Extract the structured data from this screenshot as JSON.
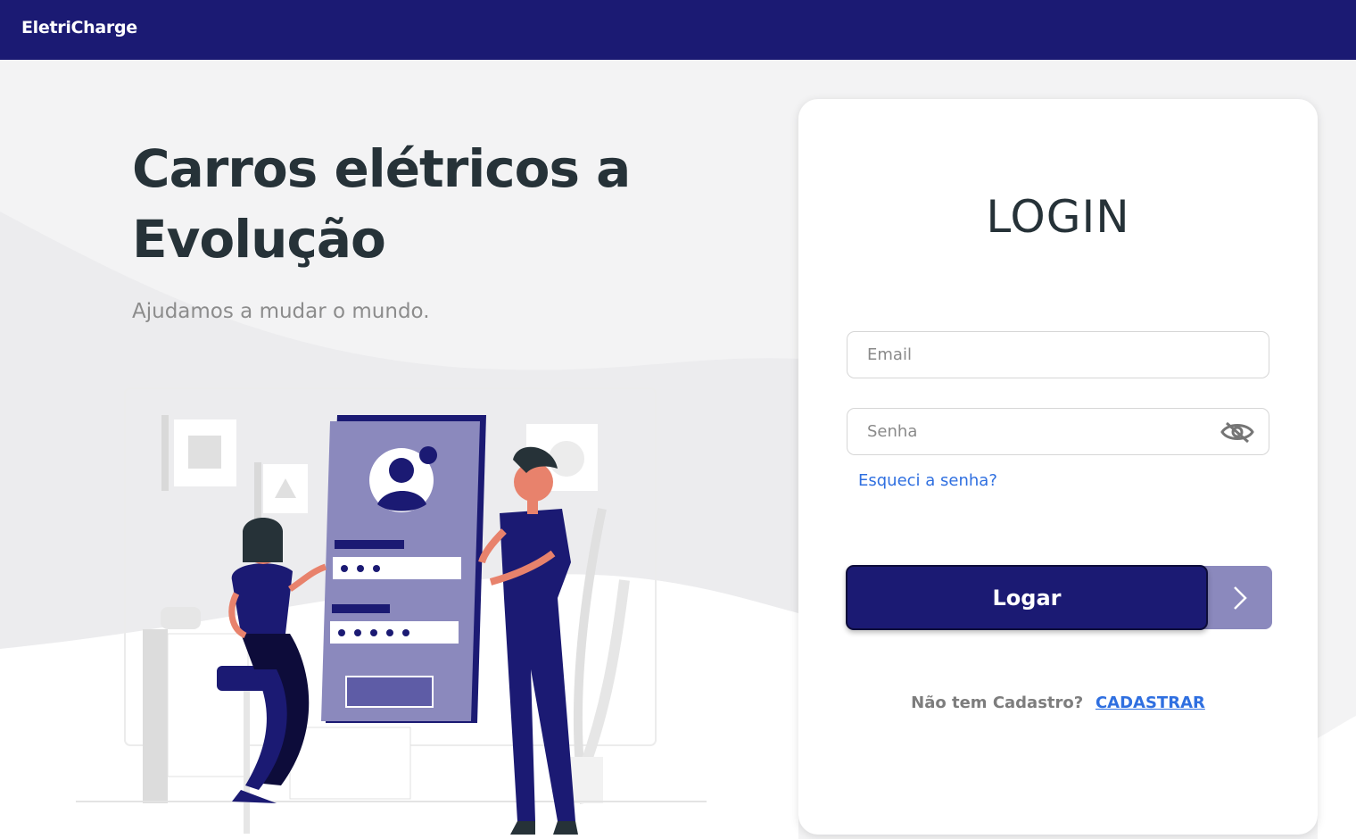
{
  "header": {
    "brand": "EletriCharge"
  },
  "hero": {
    "title": "Carros elétricos a Evolução",
    "subtitle": "Ajudamos a mudar o mundo."
  },
  "illustration": {
    "icons": [
      "person-seated-icon",
      "person-standing-icon",
      "phone-login-screen-icon",
      "plant-icon"
    ],
    "colors": {
      "primary": "#1b1a73",
      "panel": "#8b89bd",
      "skin": "#e8826c"
    }
  },
  "login": {
    "title": "LOGIN",
    "email_placeholder": "Email",
    "password_placeholder": "Senha",
    "forgot_label": "Esqueci a senha?",
    "submit_label": "Logar",
    "signup_prompt": "Não tem Cadastro?",
    "signup_link": "CADASTRAR"
  },
  "colors": {
    "brand": "#1b1a73",
    "accent_light": "#8b89bd",
    "link": "#2f6fe0",
    "heading": "#263238"
  }
}
